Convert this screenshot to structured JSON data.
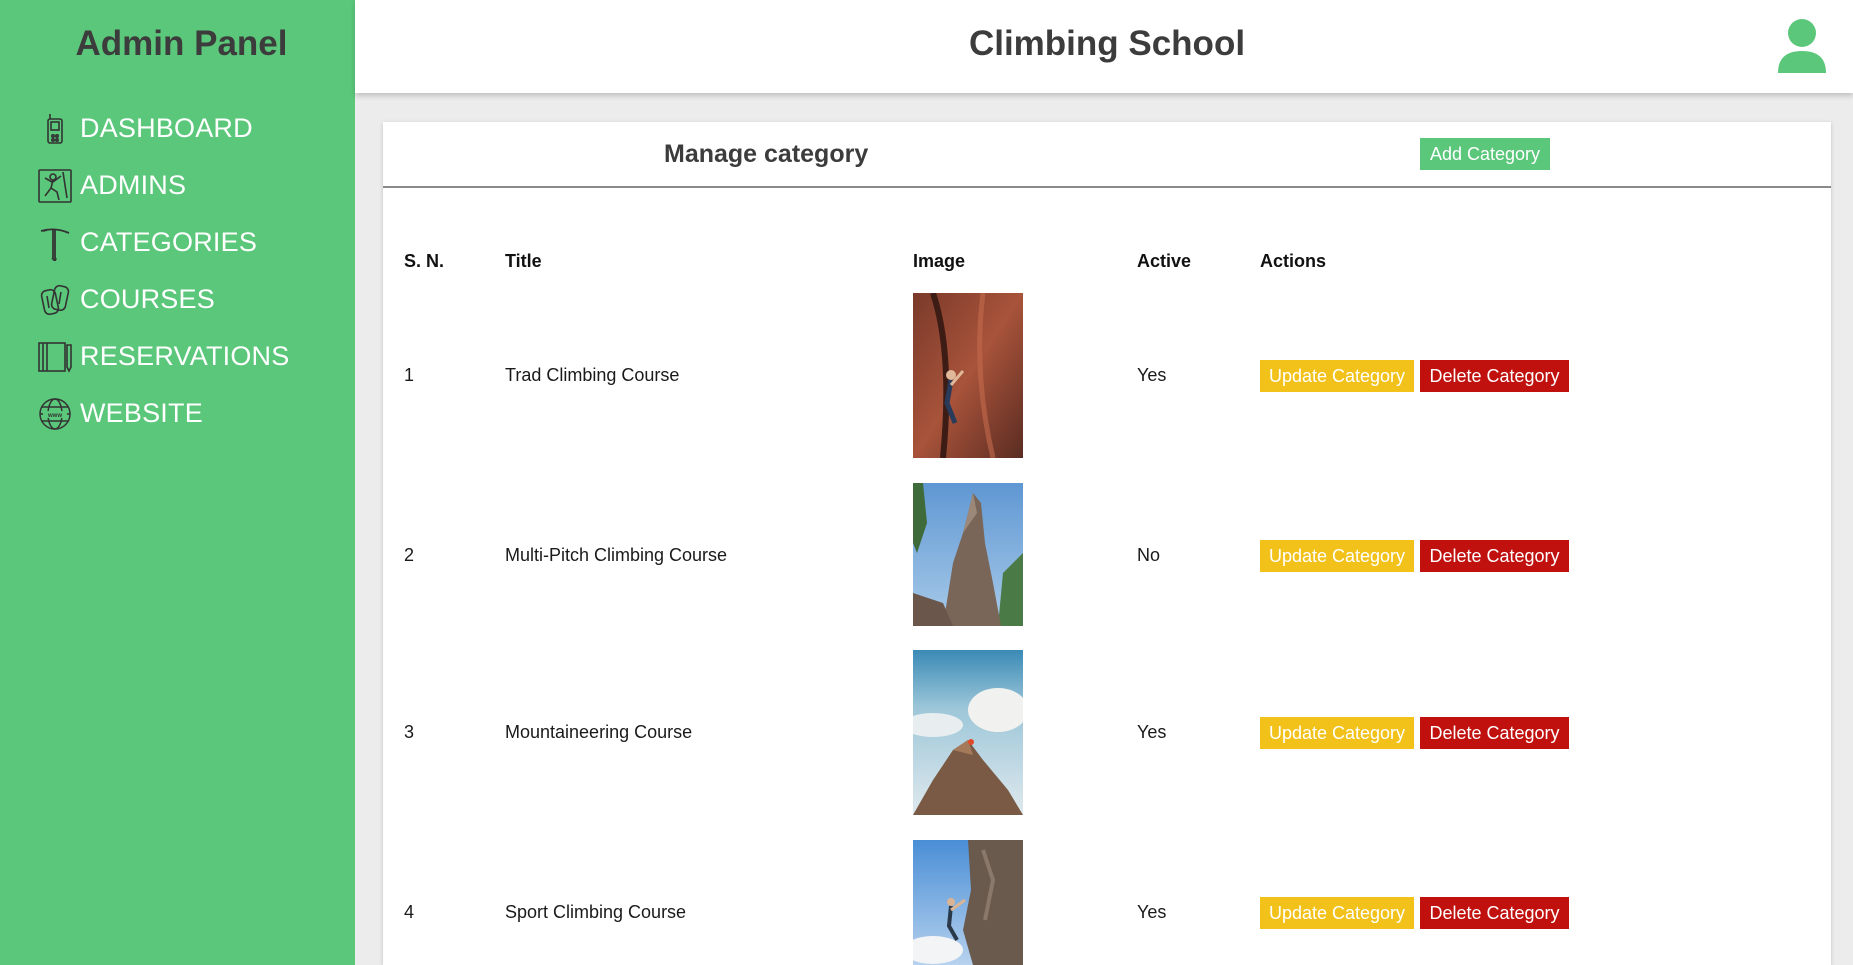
{
  "sidebar": {
    "title": "Admin Panel",
    "items": [
      {
        "label": "DASHBOARD",
        "icon": "gps-device-icon"
      },
      {
        "label": "ADMINS",
        "icon": "climber-icon"
      },
      {
        "label": "CATEGORIES",
        "icon": "ice-axe-icon"
      },
      {
        "label": "COURSES",
        "icon": "carabiner-icon"
      },
      {
        "label": "RESERVATIONS",
        "icon": "notebook-icon"
      },
      {
        "label": "WEBSITE",
        "icon": "globe-www-icon"
      }
    ]
  },
  "header": {
    "title": "Climbing School",
    "avatar_icon": "user-avatar-icon"
  },
  "card": {
    "title": "Manage category",
    "add_label": "Add Category"
  },
  "table": {
    "headers": {
      "sn": "S. N.",
      "title": "Title",
      "image": "Image",
      "active": "Active",
      "actions": "Actions"
    },
    "rows": [
      {
        "sn": "1",
        "title": "Trad Climbing Course",
        "active": "Yes",
        "update": "Update Category",
        "delete": "Delete Category"
      },
      {
        "sn": "2",
        "title": "Multi-Pitch Climbing Course",
        "active": "No",
        "update": "Update Category",
        "delete": "Delete Category"
      },
      {
        "sn": "3",
        "title": "Mountaineering Course",
        "active": "Yes",
        "update": "Update Category",
        "delete": "Delete Category"
      },
      {
        "sn": "4",
        "title": "Sport Climbing Course",
        "active": "Yes",
        "update": "Update Category",
        "delete": "Delete Category"
      }
    ]
  },
  "colors": {
    "brand_green": "#5bc77a",
    "update_yellow": "#f2c21b",
    "delete_red": "#c0110f"
  }
}
